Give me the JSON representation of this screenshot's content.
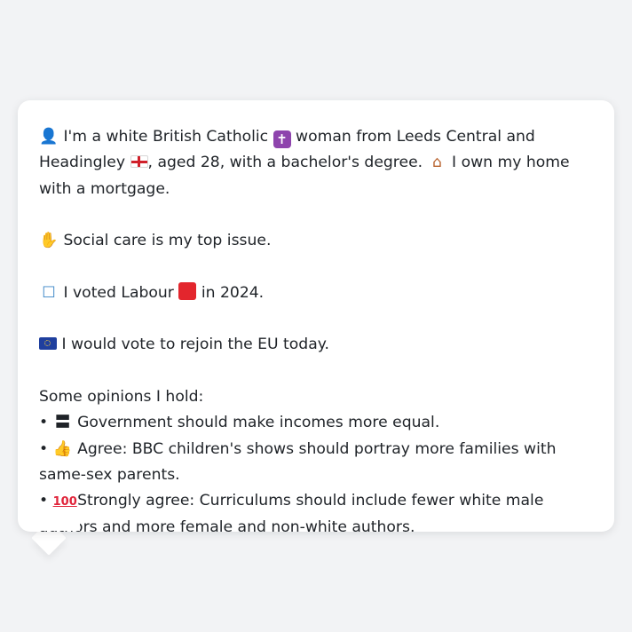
{
  "message": {
    "intro": {
      "person_icon": "person-silhouette-icon",
      "text_a": "I'm a white British Catholic",
      "religion_icon": "latin-cross-icon",
      "text_b": "woman from Leeds Central and Headingley",
      "region_flag": "england-flag-icon",
      "text_c": ", aged 28, with a bachelor's degree.",
      "home_icon": "house-icon",
      "text_d": "I own my home with a mortgage."
    },
    "top_issue": {
      "icon": "handshake-icon",
      "text": "Social care is my top issue."
    },
    "vote": {
      "icon": "ballot-box-icon",
      "text_a": "I voted Labour",
      "party_icon": "red-square-icon",
      "text_b": "in 2024."
    },
    "eu": {
      "icon": "eu-flag-icon",
      "text": "I would vote to rejoin the EU today."
    },
    "opinions_heading": "Some opinions I hold:",
    "opinions": [
      {
        "bullet": "•",
        "icon": "equals-icon",
        "text": "Government should make incomes more equal."
      },
      {
        "bullet": "•",
        "icon": "thumbs-up-icon",
        "text": "Agree: BBC children's shows should portray more families with same-sex parents."
      },
      {
        "bullet": "•",
        "icon": "hundred-points-icon",
        "text": "Strongly agree: Curriculums should include fewer white male authors and more female and non-white authors."
      }
    ]
  },
  "colors": {
    "page_background": "#f2f3f5",
    "bubble_background": "#ffffff",
    "text": "#1f2328",
    "labour_red": "#e3262d",
    "catholic_purple": "#8e44ad"
  }
}
